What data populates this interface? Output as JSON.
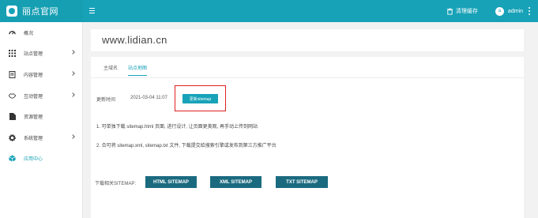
{
  "app": {
    "title": "丽点官网"
  },
  "topbar": {
    "clear_cache": "清理缓存",
    "avatar_letter": "a",
    "user_name": "admin"
  },
  "sidebar": {
    "items": [
      {
        "label": "概况"
      },
      {
        "label": "站点管理"
      },
      {
        "label": "内容管理"
      },
      {
        "label": "互动管理"
      },
      {
        "label": "资源管理"
      },
      {
        "label": "系统管理"
      },
      {
        "label": "应用中心"
      }
    ]
  },
  "main": {
    "site_title": "www.lidian.cn",
    "tabs": [
      {
        "label": "主域名"
      },
      {
        "label": "站点地图"
      }
    ],
    "update_time_label": "更新时间",
    "update_time_value": "2021-03-04 11:07",
    "update_button": "更新sitemap",
    "tips": [
      "1. 可单独下载 sitemap.html 页面, 进行设计, 让页面更美观, 再手动上传到网站",
      "2. 合可将 sitemap.xml, sitemap.txt 文件, 下载提交给搜索引擎或发布到第三方推广平台"
    ],
    "download_label": "下载相关SITEMAP:",
    "download_buttons": [
      {
        "label": "HTML SITEMAP"
      },
      {
        "label": "XML SITEMAP"
      },
      {
        "label": "TXT SITEMAP"
      }
    ]
  },
  "colors": {
    "primary": "#17a2b8",
    "download_button": "#1b6b80",
    "highlight": "#e02020"
  }
}
